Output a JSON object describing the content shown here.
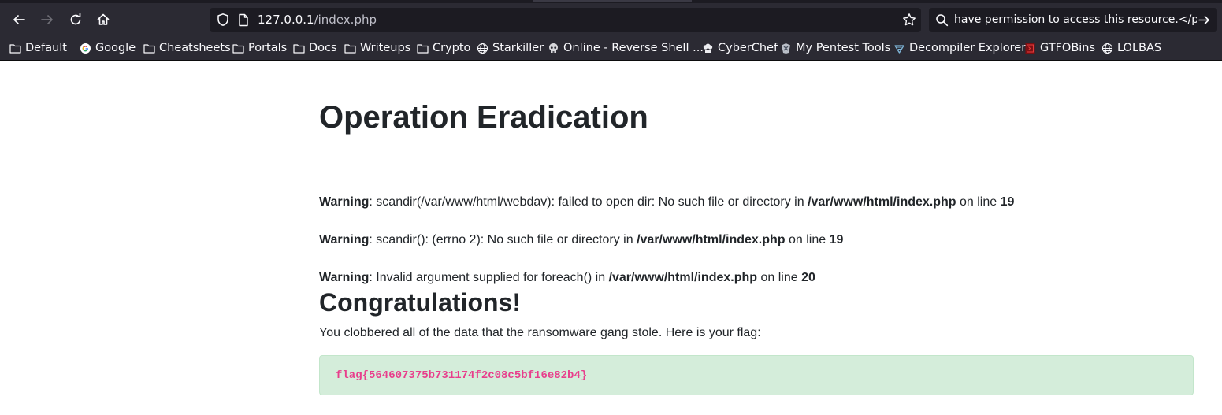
{
  "browser": {
    "url_host": "127.0.0.1",
    "url_path": "/index.php",
    "search_text": "have permission to access this resource.</p>"
  },
  "bookmarks": [
    {
      "label": "Default",
      "icon": "folder-icon"
    },
    {
      "label": "Google",
      "icon": "google-icon"
    },
    {
      "label": "Cheatsheets",
      "icon": "folder-icon"
    },
    {
      "label": "Portals",
      "icon": "folder-icon"
    },
    {
      "label": "Docs",
      "icon": "folder-icon"
    },
    {
      "label": "Writeups",
      "icon": "folder-icon"
    },
    {
      "label": "Crypto",
      "icon": "folder-icon"
    },
    {
      "label": "Starkiller",
      "icon": "globe-icon"
    },
    {
      "label": "Online - Reverse Shell ...",
      "icon": "skull-icon"
    },
    {
      "label": "CyberChef",
      "icon": "chef-icon"
    },
    {
      "label": "My Pentest Tools",
      "icon": "pentest-icon"
    },
    {
      "label": "Decompiler Explorer",
      "icon": "decompiler-icon"
    },
    {
      "label": "GTFOBins",
      "icon": "gtfobins-icon"
    },
    {
      "label": "LOLBAS",
      "icon": "globe-icon"
    }
  ],
  "page": {
    "title": "Operation Eradication",
    "warnings": [
      {
        "label": "Warning",
        "text": ": scandir(/var/www/html/webdav): failed to open dir: No such file or directory in ",
        "file": "/var/www/html/index.php",
        "on_line": " on line ",
        "line": "19"
      },
      {
        "label": "Warning",
        "text": ": scandir(): (errno 2): No such file or directory in ",
        "file": "/var/www/html/index.php",
        "on_line": " on line ",
        "line": "19"
      },
      {
        "label": "Warning",
        "text": ": Invalid argument supplied for foreach() in ",
        "file": "/var/www/html/index.php",
        "on_line": " on line ",
        "line": "20"
      }
    ],
    "congrats_heading": "Congratulations!",
    "message": "You clobbered all of the data that the ransomware gang stole. Here is your flag:",
    "flag": "flag{564607375b731174f2c08c5bf16e82b4}"
  },
  "colors": {
    "chrome_bg": "#2b2a33",
    "field_bg": "#1c1b22",
    "flag_bg": "#d4edda",
    "flag_text": "#e83e8c"
  }
}
